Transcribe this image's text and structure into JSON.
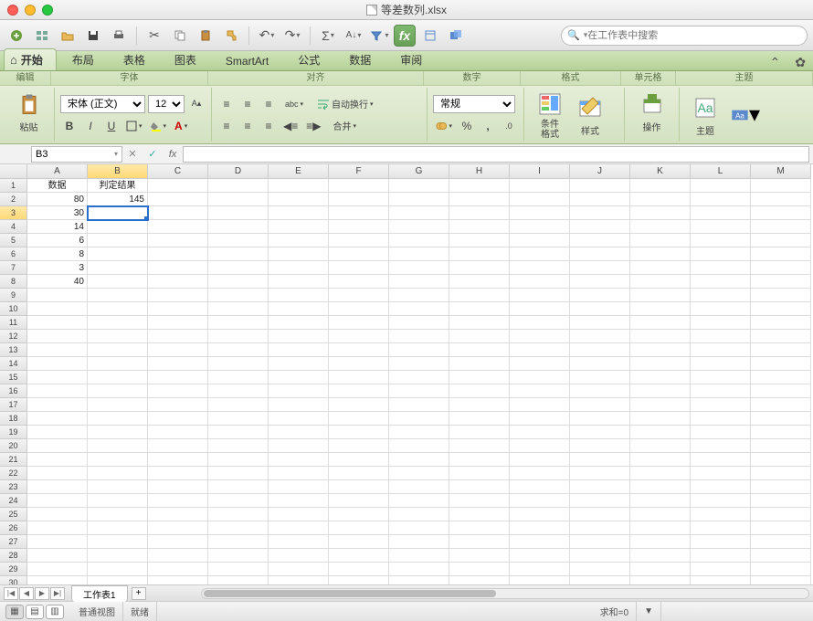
{
  "title": "等差数列.xlsx",
  "search_placeholder": "在工作表中搜索",
  "tabs": [
    "开始",
    "布局",
    "表格",
    "图表",
    "SmartArt",
    "公式",
    "数据",
    "审阅"
  ],
  "active_tab": 0,
  "ribbon_groups": {
    "edit": "编辑",
    "font": "字体",
    "align": "对齐",
    "number": "数字",
    "format": "格式",
    "cell": "单元格",
    "theme": "主题"
  },
  "font": {
    "name": "宋体 (正文)",
    "size": "12"
  },
  "align": {
    "wrap": "自动换行",
    "merge": "合并"
  },
  "number_format": "常规",
  "bigbtns": {
    "paste": "粘贴",
    "condfmt": "条件\n格式",
    "styles": "样式",
    "actions": "操作",
    "theme": "主题"
  },
  "namebox": "B3",
  "columns": [
    "A",
    "B",
    "C",
    "D",
    "E",
    "F",
    "G",
    "H",
    "I",
    "J",
    "K",
    "L",
    "M"
  ],
  "selected_col_idx": 1,
  "selected_row_idx": 2,
  "data_rows": [
    [
      "数据",
      "判定结果"
    ],
    [
      "80",
      "145"
    ],
    [
      "30",
      ""
    ],
    [
      "14",
      ""
    ],
    [
      "6",
      ""
    ],
    [
      "8",
      ""
    ],
    [
      "3",
      ""
    ],
    [
      "40",
      ""
    ]
  ],
  "total_rows": 30,
  "sheet_name": "工作表1",
  "status": {
    "view": "普通视图",
    "ready": "就绪",
    "sum": "求和=0"
  }
}
